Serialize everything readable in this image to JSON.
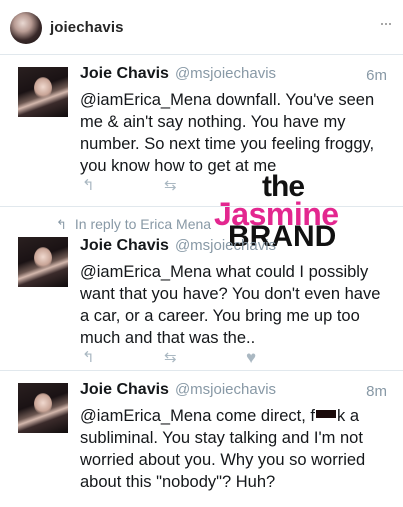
{
  "header": {
    "username": "joiechavis",
    "more_icon": "ellipsis-icon",
    "more_label": "···"
  },
  "tweets": [
    {
      "name": "Joie Chavis",
      "handle": "@msjoiechavis",
      "time": "6m",
      "text": "@iamErica_Mena downfall. You've seen me & ain't say nothing. You have my number. So next time you feeling froggy, you know how to get at me"
    },
    {
      "reply_to": "In reply to Erica Mena",
      "name": "Joie Chavis",
      "handle": "@msjoiechavis",
      "time": "",
      "text": "@iamErica_Mena what could I possibly want that you have? You don't even have a car, or a career. You bring me up too much and that was the.."
    },
    {
      "name": "Joie Chavis",
      "handle": "@msjoiechavis",
      "time": "8m",
      "text_before": "@iamErica_Mena come direct, f",
      "text_after": "k a subliminal. You stay talking and I'm not worried about you. Why you so worried about this \"nobody\"? Huh?"
    }
  ],
  "actions": {
    "reply_icon": "reply-icon",
    "reply_glyph": "↰",
    "retweet_icon": "retweet-icon",
    "retweet_glyph": "⇆",
    "like_icon": "heart-icon",
    "like_glyph": "♥"
  },
  "watermark": {
    "line1": "the",
    "line2": "Jasmine",
    "line3": "BRAND"
  },
  "colors": {
    "brand_pink": "#e3278f",
    "muted": "#8899a6",
    "icon_gray": "#aab8c2"
  }
}
